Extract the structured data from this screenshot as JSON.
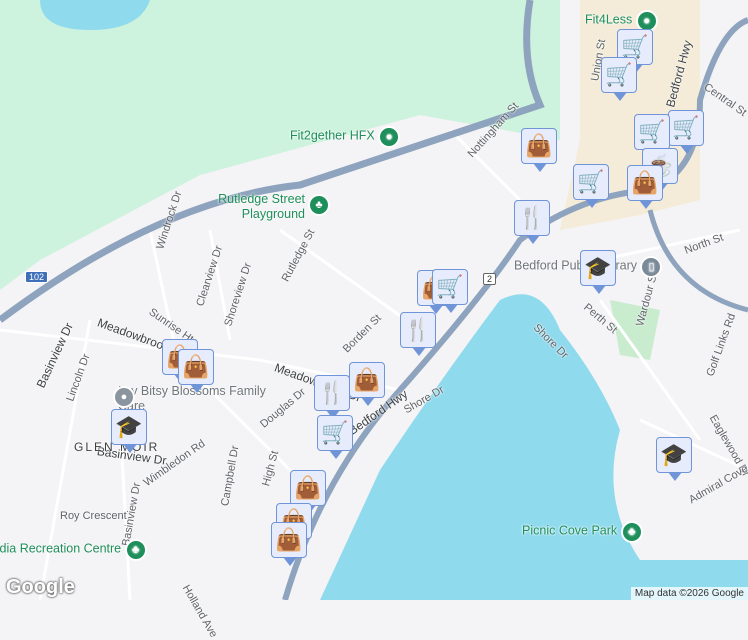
{
  "streets": [
    "Windrock Dr",
    "Clearview Dr",
    "Shoreview Dr",
    "Rutledge St",
    "Sunrise Hts",
    "Meadowbrook Dr",
    "Meadowbrook Dr",
    "Basinview Dr",
    "Lincoln Dr",
    "Douglas Dr",
    "Wimbledon Rd",
    "Campbell Dr",
    "High St",
    "Basinview Dr",
    "Roy Crescent",
    "Basinview Dr",
    "Borden St",
    "Shore Dr",
    "Bedford Hwy",
    "Nottingham St",
    "Union St",
    "Bedford Hwy",
    "Central St",
    "North St",
    "Wardour St",
    "Perth St",
    "Shore Dr",
    "Golf Links Rd",
    "Eaglewood Dr",
    "Admiral Cove Dr",
    "Holland Ave"
  ],
  "pois": {
    "fit2gether": "Fit2gether HFX",
    "rutledge": "Rutledge Street Playground",
    "fit4less": "Fit4Less",
    "library": "Bedford Public Library",
    "itsy": "Itsy Bitsy Blossoms Family Care",
    "picnic": "Picnic Cove Park",
    "recreation": "Acadia Recreation Centre"
  },
  "neighbourhood": "GLEN MOIR",
  "shields": {
    "hwy102": "102",
    "hwy2": "2"
  },
  "markers": [
    "shopping-cart",
    "shopping-cart",
    "shopping-bag",
    "shopping-cart",
    "shopping-cart",
    "shopping-cart",
    "coffee-cup",
    "shopping-bag",
    "restaurant",
    "shopping-bag",
    "shopping-cart",
    "restaurant",
    "shopping-bag",
    "shopping-bag",
    "restaurant",
    "shopping-bag",
    "shopping-cart",
    "school",
    "school",
    "school",
    "shopping-bag",
    "shopping-bag",
    "shopping-bag"
  ],
  "footer": {
    "logo": "Google",
    "attribution": "Map data ©2026 Google"
  },
  "colors": {
    "water": "#90daee",
    "park": "#c9f1da",
    "highway": "#8ea3bd",
    "marker": "#0b4470"
  }
}
